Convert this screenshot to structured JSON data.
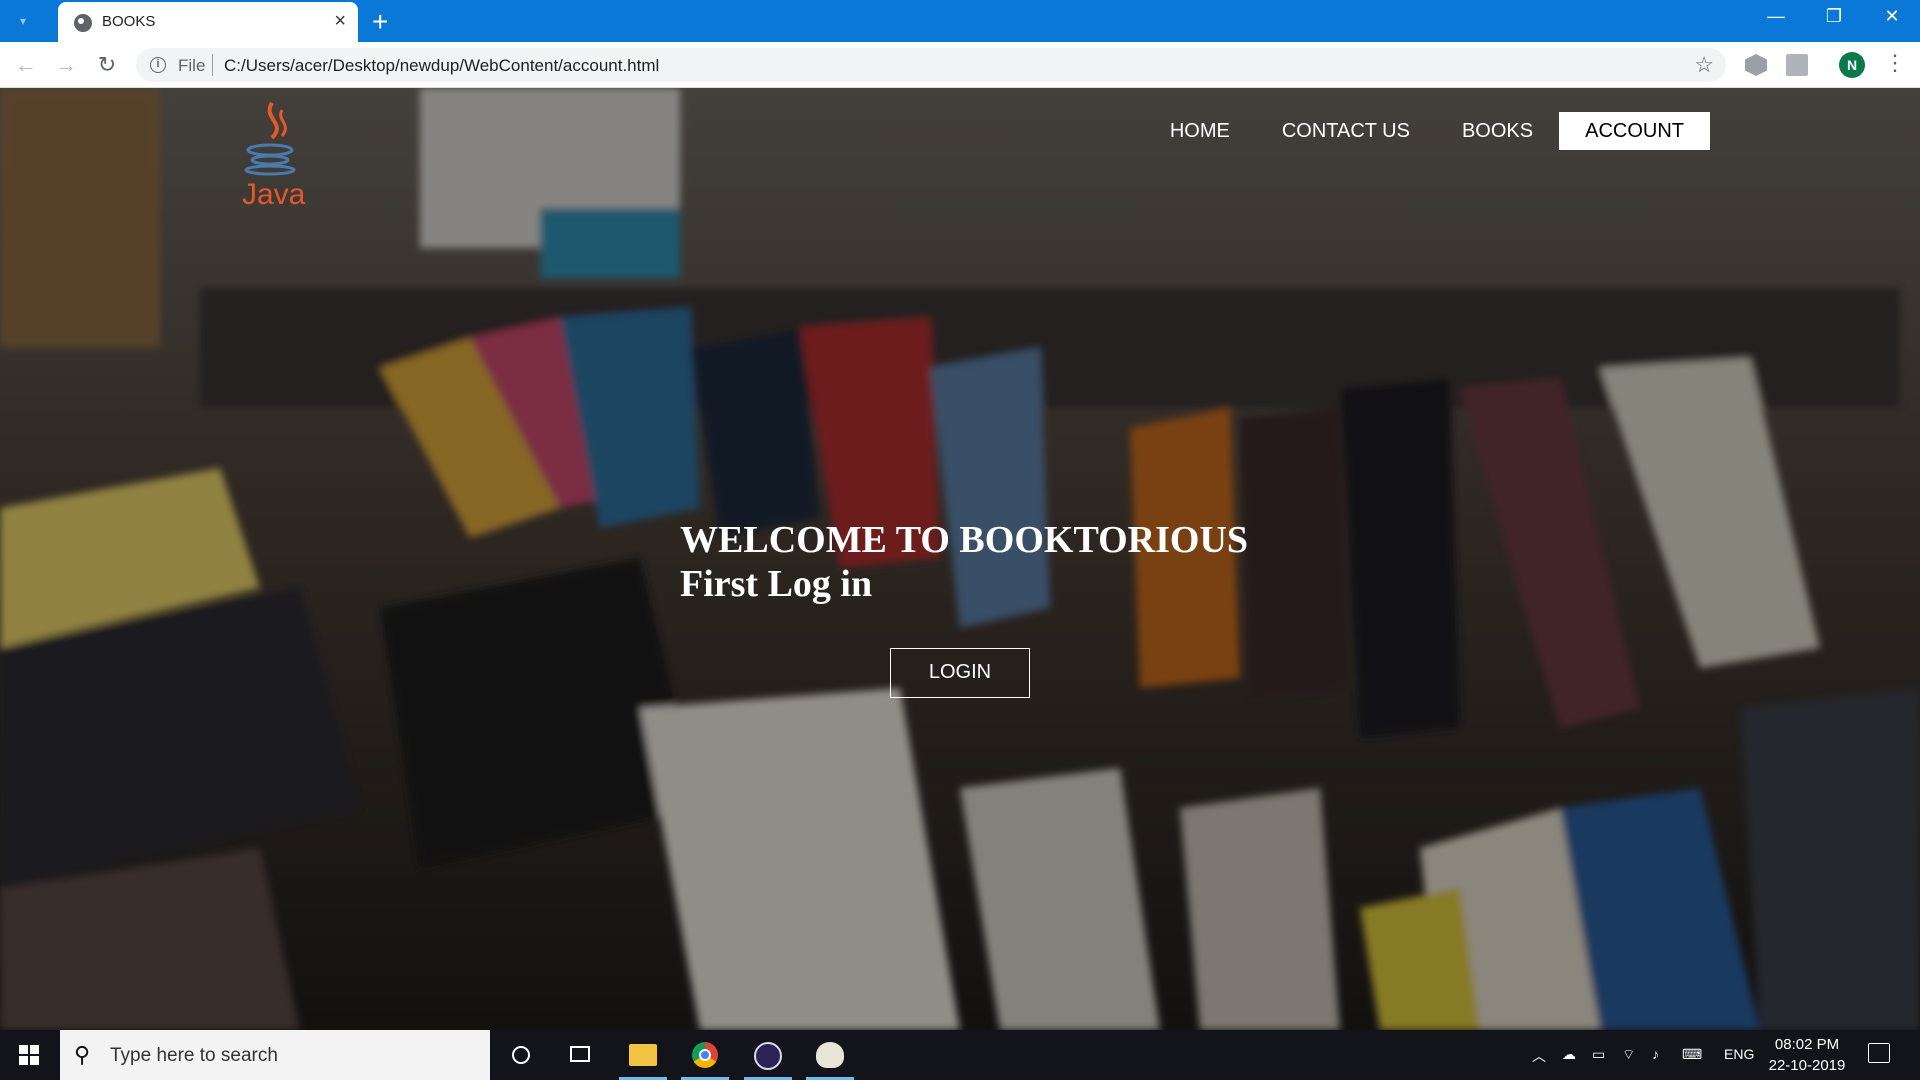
{
  "browser": {
    "tab_title": "BOOKS",
    "address_scheme": "File",
    "url": "C:/Users/acer/Desktop/newdup/WebContent/account.html",
    "profile_initial": "N"
  },
  "site": {
    "logo_text": "Java",
    "nav": [
      {
        "label": "HOME",
        "active": false
      },
      {
        "label": "CONTACT US",
        "active": false
      },
      {
        "label": "BOOKS",
        "active": false
      },
      {
        "label": "ACCOUNT",
        "active": true
      }
    ],
    "hero_line1": "WELCOME TO BOOKTORIOUS",
    "hero_line2": "First Log in",
    "login_label": "LOGIN"
  },
  "taskbar": {
    "search_placeholder": "Type here to search",
    "language": "ENG",
    "time": "08:02 PM",
    "date": "22-10-2019"
  },
  "colors": {
    "titlebar": "#0a78d7",
    "taskbar": "#12141a",
    "logo_accent": "#e2592a"
  }
}
